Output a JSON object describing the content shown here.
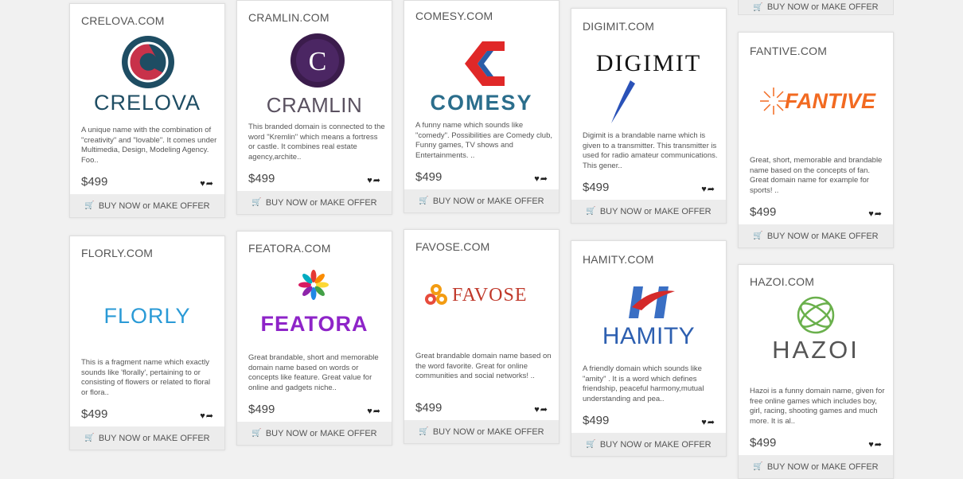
{
  "buy_label": "BUY NOW or MAKE OFFER",
  "cards": [
    {
      "domain": "CRELOVA.COM",
      "logo_text": "CRELOVA",
      "desc": "A unique name with the combination of  \"creativity\" and \"lovable\". It comes under Multimedia, Design, Modeling Agency. Foo..",
      "price": "$499"
    },
    {
      "domain": "CRAMLIN.COM",
      "logo_text": "CRAMLIN",
      "desc": "This branded domain is connected to the word \"Kremlin\" which means a fortress or castle. It combines real estate agency,archite..",
      "price": "$499"
    },
    {
      "domain": "COMESY.COM",
      "logo_text": "COMESY",
      "desc": "A funny name which sounds like \"comedy\".  Possibilities are Comedy club, Funny games, TV shows and Entertainments.  ..",
      "price": "$499"
    },
    {
      "domain": "DIGIMIT.COM",
      "logo_text": "DIGIMIT",
      "desc": "Digimit is a brandable name which is given to a transmitter. This transmitter is used for radio amateur communications. This gener..",
      "price": "$499"
    },
    {
      "domain": "FANTIVE.COM",
      "logo_text": "FANTIVE",
      "desc": "Great, short, memorable and brandable name based on the concepts of fan. Great domain name for example for sports! ..",
      "price": "$499"
    },
    {
      "domain": "FLORLY.COM",
      "logo_text": "FLORLY",
      "desc": "This is a fragment name which exactly sounds like 'florally', pertaining to or consisting of flowers or related to floral or flora..",
      "price": "$499"
    },
    {
      "domain": "FEATORA.COM",
      "logo_text": "FEATORA",
      "desc": "Great brandable, short and memorable domain name based on words or concepts like feature. Great value for online and gadgets niche..",
      "price": "$499"
    },
    {
      "domain": "FAVOSE.COM",
      "logo_text": "FAVOSE",
      "desc": "Great brandable domain name based on the word favorite. Great for online communities and social networks! ..",
      "price": "$499"
    },
    {
      "domain": "HAMITY.COM",
      "logo_text": "HAMITY",
      "desc": "A friendly domain which sounds like \"amity\" . It is a word which defines friendship, peaceful harmony,mutual understanding and pea..",
      "price": "$499"
    },
    {
      "domain": "HAZOI.COM",
      "logo_text": "HAZOI",
      "desc": "Hazoi is a funny domain name, given for free online games which includes boy, girl, racing, shooting games and much more. It is al..",
      "price": "$499"
    }
  ]
}
